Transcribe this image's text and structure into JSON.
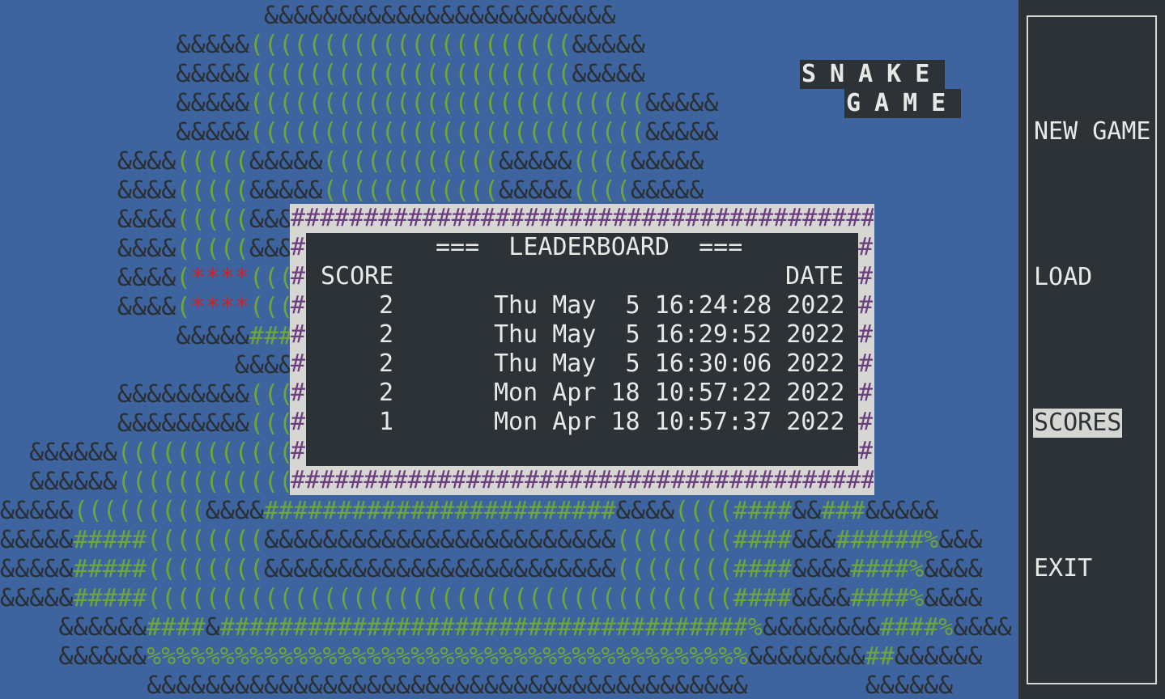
{
  "title": {
    "line1": "SNAKE",
    "line2": "GAME"
  },
  "menu": {
    "items": [
      {
        "label": "NEW GAME",
        "selected": false
      },
      {
        "label": "LOAD",
        "selected": false
      },
      {
        "label": "SCORES",
        "selected": true
      },
      {
        "label": "EXIT",
        "selected": false
      }
    ]
  },
  "leaderboard": {
    "heading": "===  LEADERBOARD  ===",
    "col_score": "SCORE",
    "col_date": "DATE",
    "rows": [
      {
        "score": "2",
        "date": "Thu May  5 16:24:28 2022"
      },
      {
        "score": "2",
        "date": "Thu May  5 16:29:52 2022"
      },
      {
        "score": "2",
        "date": "Thu May  5 16:30:06 2022"
      },
      {
        "score": "2",
        "date": "Mon Apr 18 10:57:22 2022"
      },
      {
        "score": "1",
        "date": "Mon Apr 18 10:57:37 2022"
      }
    ]
  },
  "map_rows": [
    "                  &&&&&&&&&&&&&&&&&&&&&&&&",
    "            &&&&&((((((((((((((((((((((&&&&&",
    "            &&&&&((((((((((((((((((((((&&&&&",
    "            &&&&&(((((((((((((((((((((((((((&&&&&",
    "            &&&&&(((((((((((((((((((((((((((&&&&&",
    "        &&&&(((((&&&&&((((((((((((&&&&&((((&&&&&",
    "        &&&&(((((&&&&&((((((((((((&&&&&((((&&&&&",
    "        &&&&(((((&&&",
    "        &&&&(((((&&&",
    "        &&&&(****((((",
    "        &&&&(****((((",
    "            &&&&&###",
    "                &&&&",
    "        &&&&&&&&&((((",
    "        &&&&&&&&&((((",
    "  &&&&&&((((((((((((",
    "  &&&&&&((((((((((((",
    "&&&&&(((((((((&&&&########################&&&&((((####&&###&&&&&",
    "&&&&&#####((((((((&&&&&&&&&&&&&&&&&&&&&&&&((((((((####&&&######%&&&",
    "&&&&&#####((((((((&&&&&&&&&&&&&&&&&&&&&&&&((((((((####&&&&####%&&&&",
    "&&&&&#####((((((((((((((((((((((((((((((((((((((((####&&&&####%&&&&",
    "    &&&&&&####&####################################%&&&&&&&&####%&&&&",
    "    &&&&&&%%%%%%%%%%%%%%%%%%%%%%%%%%%%%%%%%%%%%%%%%&&&&&&&&##&&&&&&",
    "          &&&&&&&&&&&&&&&&&&&&&&&&&&&&&&&&&&&&&&&&&        &&&&&&"
  ],
  "board_border_char": "#"
}
